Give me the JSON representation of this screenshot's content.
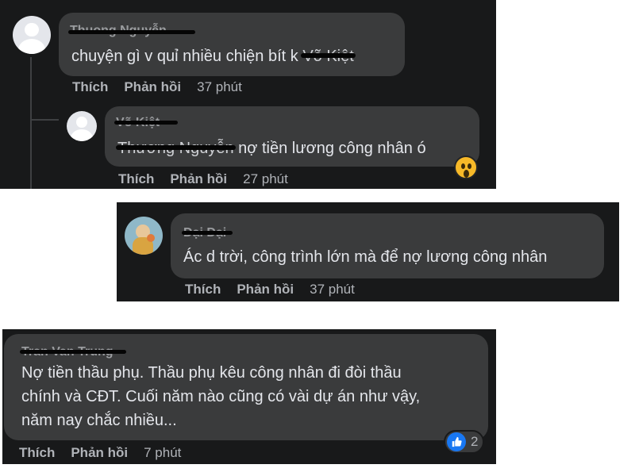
{
  "comments": [
    {
      "text_prefix": "chuyện gì v quỉ nhiều chiện bít k",
      "mention": "Võ Kiệt",
      "actions": {
        "like": "Thích",
        "reply": "Phản hồi",
        "time": "37 phút"
      }
    },
    {
      "mention": "Thương Nguyễn",
      "text_suffix": " nợ tiền lương công nhân ó",
      "actions": {
        "like": "Thích",
        "reply": "Phản hồi",
        "time": "27 phút"
      },
      "reaction_icon": "wow-icon"
    },
    {
      "text": "Ác d trời, công trình lớn mà để nợ lương công nhân",
      "actions": {
        "like": "Thích",
        "reply": "Phản hồi",
        "time": "37 phút"
      }
    },
    {
      "text_lines": [
        "Nợ tiền thầu phụ. Thầu phụ kêu công nhân đi đòi thầu",
        "chính và CĐT. Cuối năm nào cũng có vài dự án như vậy,",
        "năm nay chắc nhiều..."
      ],
      "actions": {
        "like": "Thích",
        "reply": "Phản hồi",
        "time": "7 phút"
      },
      "reaction_icon": "like-icon",
      "reaction_count": "2"
    }
  ],
  "colors": {
    "panel_bg": "#18191a",
    "bubble_bg": "#3a3b3c",
    "text": "#e4e6eb",
    "secondary_text": "#b0b3b8",
    "like_blue": "#1877f2",
    "wow_yellow": "#f7b928"
  }
}
